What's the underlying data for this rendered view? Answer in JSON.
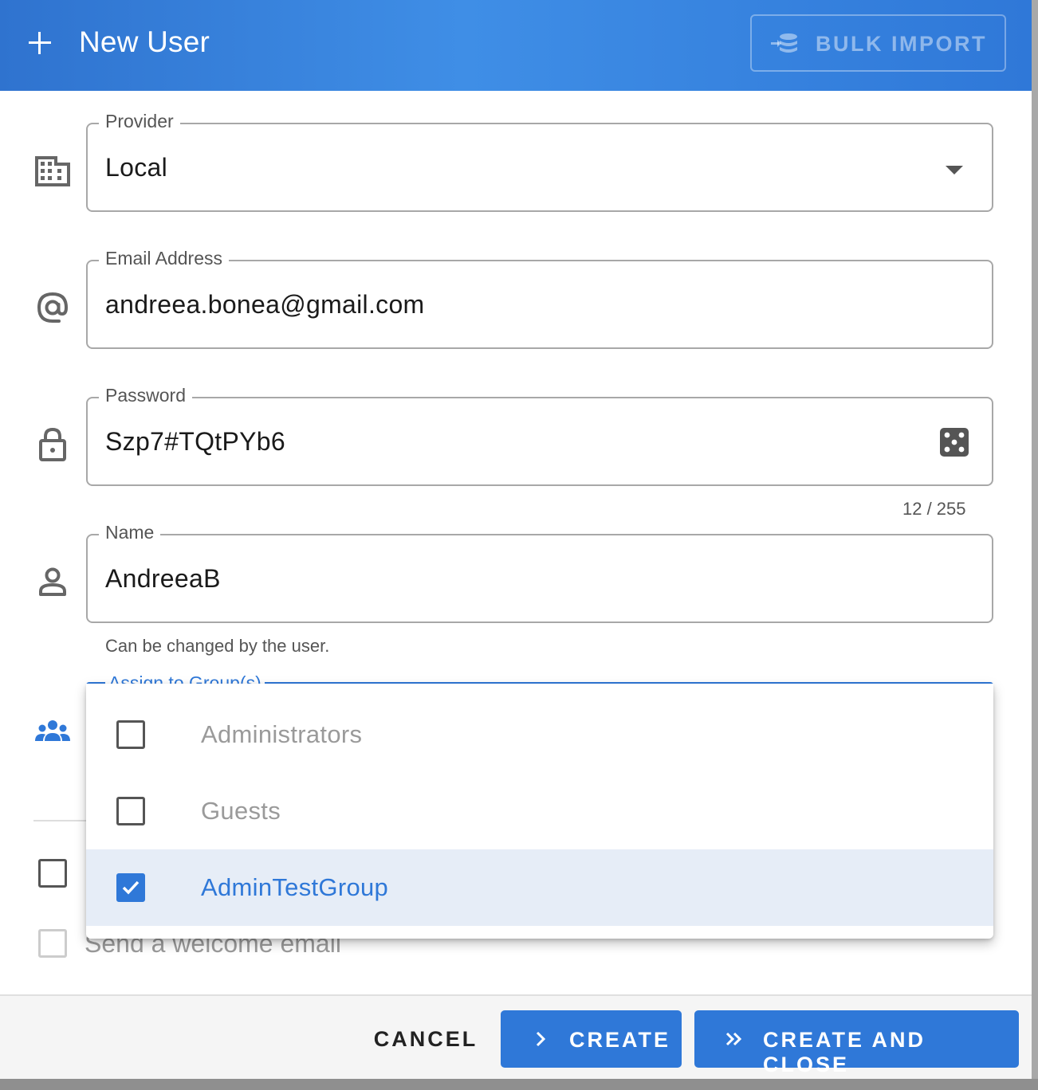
{
  "header": {
    "title": "New User",
    "bulk_import_label": "BULK IMPORT"
  },
  "fields": {
    "provider": {
      "label": "Provider",
      "value": "Local"
    },
    "email": {
      "label": "Email Address",
      "value": "andreea.bonea@gmail.com"
    },
    "password": {
      "label": "Password",
      "value": "Szp7#TQtPYb6",
      "counter": "12 / 255"
    },
    "name": {
      "label": "Name",
      "value": "AndreeaB",
      "helper": "Can be changed by the user."
    },
    "groups": {
      "label": "Assign to Group(s)"
    }
  },
  "group_options": [
    {
      "label": "Administrators",
      "checked": false
    },
    {
      "label": "Guests",
      "checked": false
    },
    {
      "label": "AdminTestGroup",
      "checked": true
    }
  ],
  "welcome_email_label": "Send a welcome email",
  "footer": {
    "cancel_label": "CANCEL",
    "create_label": "CREATE",
    "create_close_label": "CREATE AND CLOSE"
  },
  "colors": {
    "primary": "#2f78d8",
    "header_gradient_mid": "#3f8ee6",
    "selected_row": "#e6edf7"
  }
}
